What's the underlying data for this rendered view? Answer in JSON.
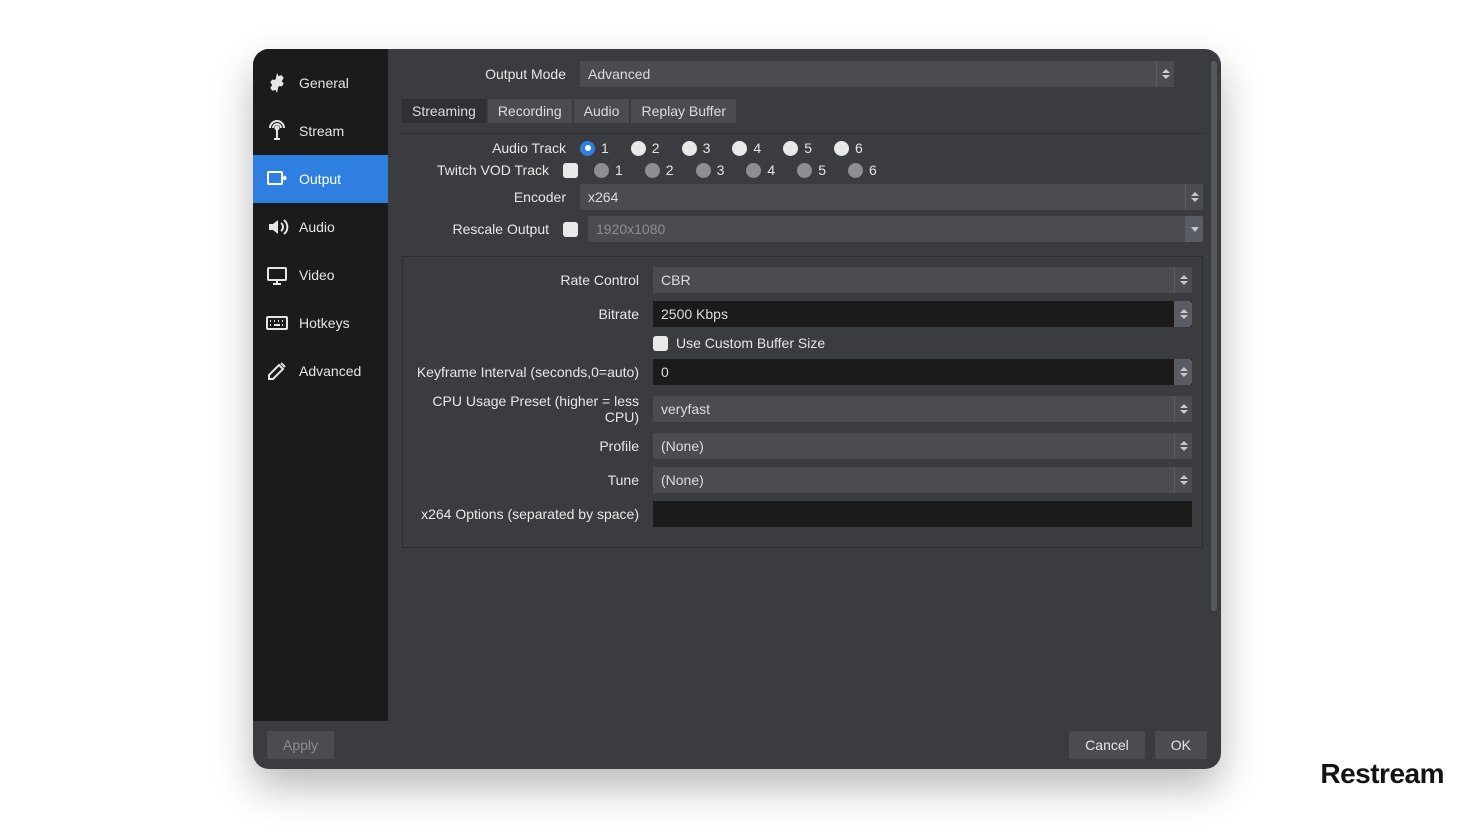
{
  "brand": "Restream",
  "sidebar": {
    "items": [
      {
        "label": "General"
      },
      {
        "label": "Stream"
      },
      {
        "label": "Output"
      },
      {
        "label": "Audio"
      },
      {
        "label": "Video"
      },
      {
        "label": "Hotkeys"
      },
      {
        "label": "Advanced"
      }
    ],
    "active_index": 2
  },
  "output_mode": {
    "label": "Output Mode",
    "value": "Advanced"
  },
  "tabs": [
    "Streaming",
    "Recording",
    "Audio",
    "Replay Buffer"
  ],
  "tabs_active_index": 0,
  "audio_track": {
    "label": "Audio Track",
    "options": [
      "1",
      "2",
      "3",
      "4",
      "5",
      "6"
    ],
    "selected_index": 0
  },
  "twitch_vod": {
    "label": "Twitch VOD Track",
    "checked": false,
    "options": [
      "1",
      "2",
      "3",
      "4",
      "5",
      "6"
    ]
  },
  "encoder": {
    "label": "Encoder",
    "value": "x264"
  },
  "rescale": {
    "label": "Rescale Output",
    "checked": false,
    "value": "1920x1080"
  },
  "rate_control": {
    "label": "Rate Control",
    "value": "CBR"
  },
  "bitrate": {
    "label": "Bitrate",
    "value": "2500 Kbps"
  },
  "custom_buffer": {
    "label": "Use Custom Buffer Size",
    "checked": false
  },
  "keyframe": {
    "label": "Keyframe Interval (seconds,0=auto)",
    "value": "0"
  },
  "cpu_preset": {
    "label": "CPU Usage Preset (higher = less CPU)",
    "value": "veryfast"
  },
  "profile": {
    "label": "Profile",
    "value": "(None)"
  },
  "tune": {
    "label": "Tune",
    "value": "(None)"
  },
  "x264_opts": {
    "label": "x264 Options (separated by space)",
    "value": ""
  },
  "buttons": {
    "apply": "Apply",
    "cancel": "Cancel",
    "ok": "OK"
  }
}
